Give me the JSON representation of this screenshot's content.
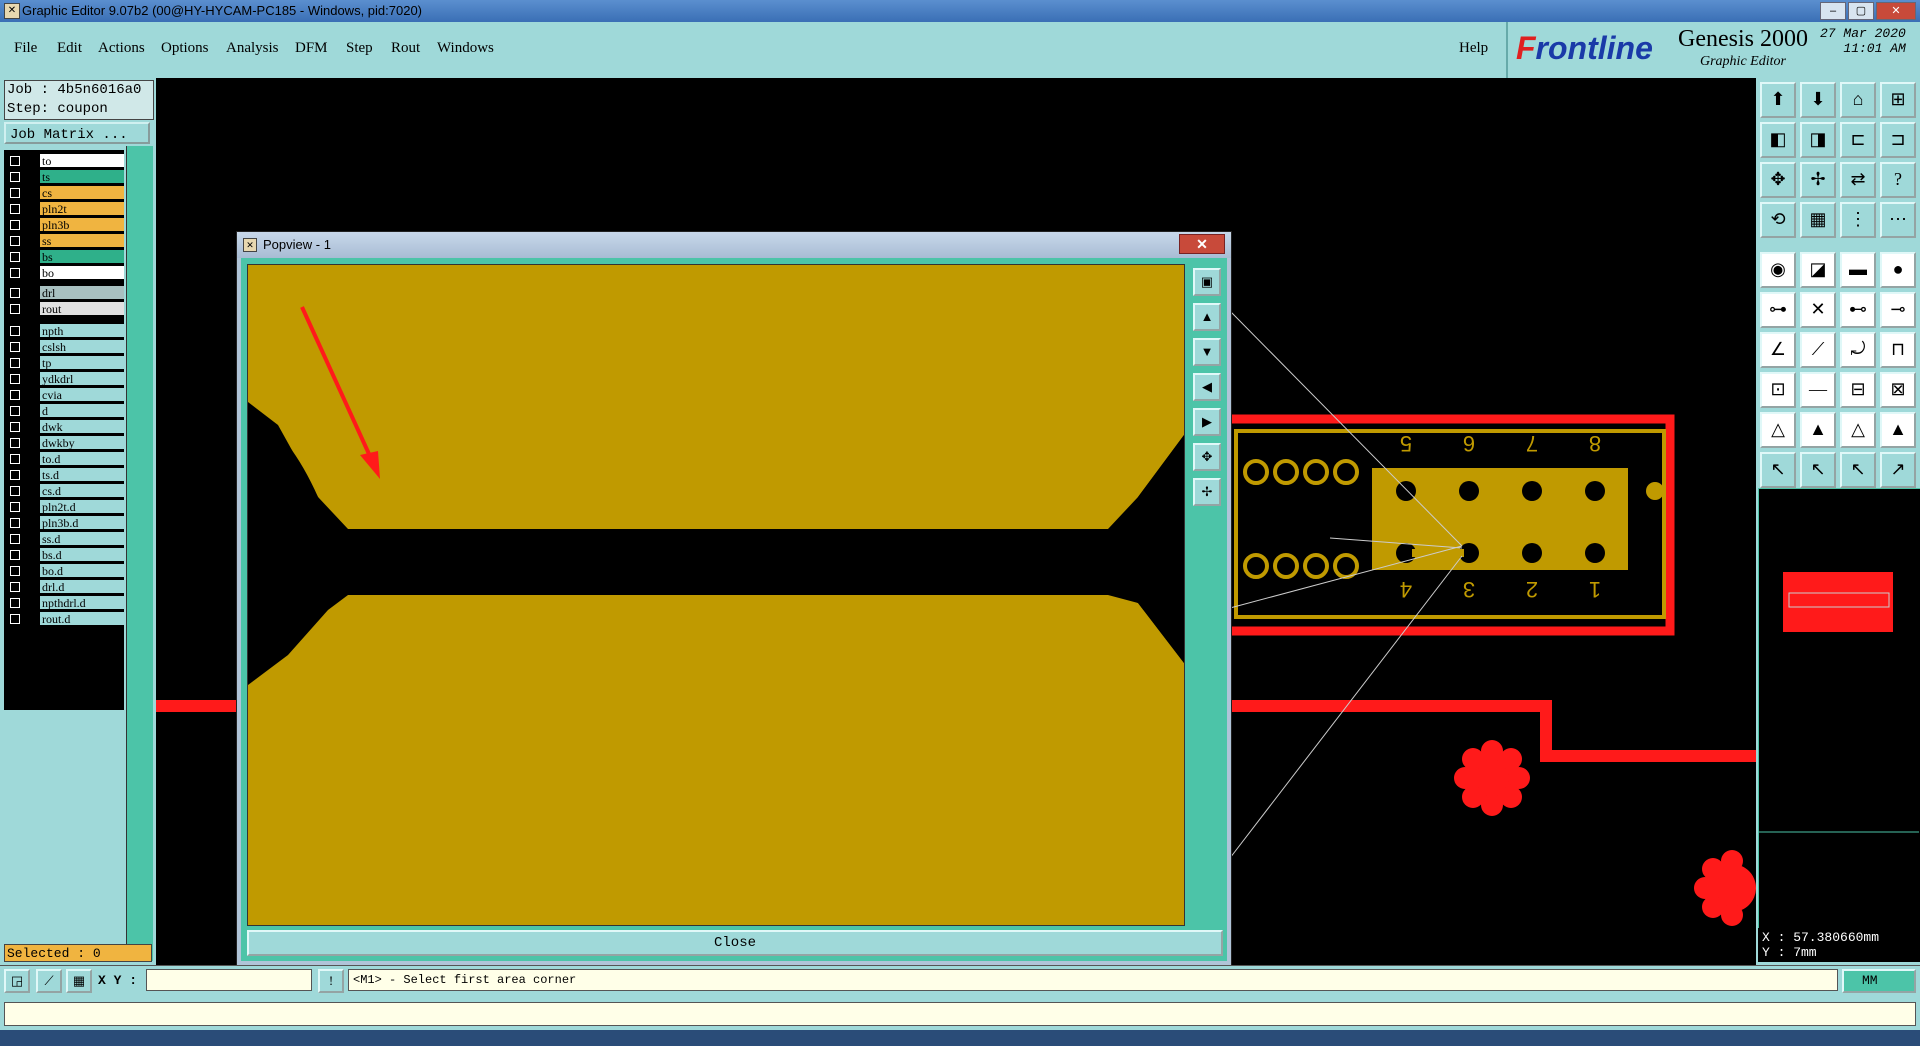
{
  "window": {
    "title": "Graphic Editor 9.07b2 (00@HY-HYCAM-PC185 - Windows, pid:7020)",
    "controls": [
      "–",
      "▢",
      "✕"
    ]
  },
  "menu": {
    "items": [
      "File",
      "Edit",
      "Actions",
      "Options",
      "Analysis",
      "DFM",
      "Step",
      "Rout",
      "Windows"
    ],
    "help": "Help"
  },
  "branding": {
    "frontline_prefix": "F",
    "frontline_rest": "rontline",
    "product": "Genesis 2000",
    "subtitle": "Graphic Editor",
    "date": "27 Mar 2020",
    "time": "11:01 AM"
  },
  "job": {
    "job_line": "Job : 4b5n6016a0",
    "step_line": "Step: coupon",
    "matrix_button": "Job Matrix ..."
  },
  "layers": [
    {
      "name": "to",
      "color": "#ffffff"
    },
    {
      "name": "ts",
      "color": "#2fb08a"
    },
    {
      "name": "cs",
      "color": "#f0b440"
    },
    {
      "name": "pln2t",
      "color": "#f0b440"
    },
    {
      "name": "pln3b",
      "color": "#f0b440"
    },
    {
      "name": "ss",
      "color": "#f0b440"
    },
    {
      "name": "bs",
      "color": "#2fb08a"
    },
    {
      "name": "bo",
      "color": "#ffffff"
    },
    {
      "name": "drl",
      "color": "#a8c0c0"
    },
    {
      "name": "rout",
      "color": "#e0e0e0"
    },
    {
      "name": "npth",
      "color": "#9fd9d9"
    },
    {
      "name": "cslsh",
      "color": "#9fd9d9"
    },
    {
      "name": "tp",
      "color": "#9fd9d9"
    },
    {
      "name": "ydkdrl",
      "color": "#9fd9d9"
    },
    {
      "name": "cvia",
      "color": "#9fd9d9"
    },
    {
      "name": "d",
      "color": "#9fd9d9"
    },
    {
      "name": "dwk",
      "color": "#9fd9d9"
    },
    {
      "name": "dwkby",
      "color": "#9fd9d9"
    },
    {
      "name": "to.d",
      "color": "#9fd9d9"
    },
    {
      "name": "ts.d",
      "color": "#9fd9d9"
    },
    {
      "name": "cs.d",
      "color": "#9fd9d9"
    },
    {
      "name": "pln2t.d",
      "color": "#9fd9d9"
    },
    {
      "name": "pln3b.d",
      "color": "#9fd9d9"
    },
    {
      "name": "ss.d",
      "color": "#9fd9d9"
    },
    {
      "name": "bs.d",
      "color": "#9fd9d9"
    },
    {
      "name": "bo.d",
      "color": "#9fd9d9"
    },
    {
      "name": "drl.d",
      "color": "#9fd9d9"
    },
    {
      "name": "npthdrl.d",
      "color": "#9fd9d9"
    },
    {
      "name": "rout.d",
      "color": "#9fd9d9"
    }
  ],
  "selected": "Selected : 0",
  "popup": {
    "title": "Popview - 1",
    "close_label": "Close",
    "close_x": "✕"
  },
  "pins": [
    "5",
    "6",
    "7",
    "8",
    "4",
    "3",
    "2",
    "1"
  ],
  "status": {
    "xy_label": "X Y :",
    "xy_value": "",
    "prompt": "<M1> - Select first area corner",
    "unit": "MM"
  },
  "coords": {
    "x": "X : 57.380660mm",
    "y": "Y :          7mm"
  },
  "colors": {
    "copper": "#c09a00",
    "highlight": "#ff1a1a",
    "panel": "#9fd9d9",
    "accent": "#4cc4a8"
  }
}
